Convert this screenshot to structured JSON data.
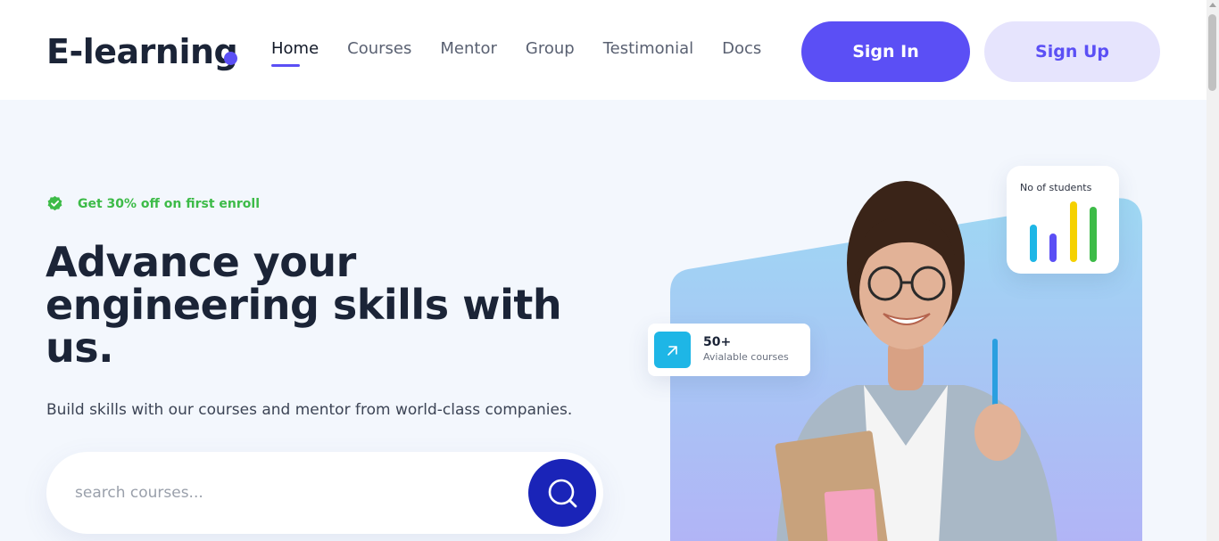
{
  "header": {
    "logo": "E-learning",
    "nav": [
      {
        "label": "Home",
        "active": true
      },
      {
        "label": "Courses",
        "active": false
      },
      {
        "label": "Mentor",
        "active": false
      },
      {
        "label": "Group",
        "active": false
      },
      {
        "label": "Testimonial",
        "active": false
      },
      {
        "label": "Docs",
        "active": false
      }
    ],
    "sign_in": "Sign In",
    "sign_up": "Sign Up"
  },
  "hero": {
    "promo": "Get 30% off on first enroll",
    "headline": "Advance your engineering skills with us.",
    "subtext": "Build skills with our courses and mentor from world-class companies.",
    "search_placeholder": "search courses...",
    "stats_card": {
      "title": "No of students",
      "bar_colors": [
        "#1eb6e6",
        "#5b4ff5",
        "#f5d100",
        "#3dbb48"
      ]
    },
    "courses_card": {
      "count": "50+",
      "label": "Avialable courses"
    }
  },
  "colors": {
    "accent": "#5b4ff5",
    "accent_light": "#e6e4fd",
    "search_button": "#1a24b8",
    "promo_green": "#3dbb48",
    "page_bg": "#f3f7fd"
  },
  "icons": {
    "search_button": "search-icon",
    "promo": "check-badge-icon",
    "courses_card": "arrow-up-left-icon"
  }
}
